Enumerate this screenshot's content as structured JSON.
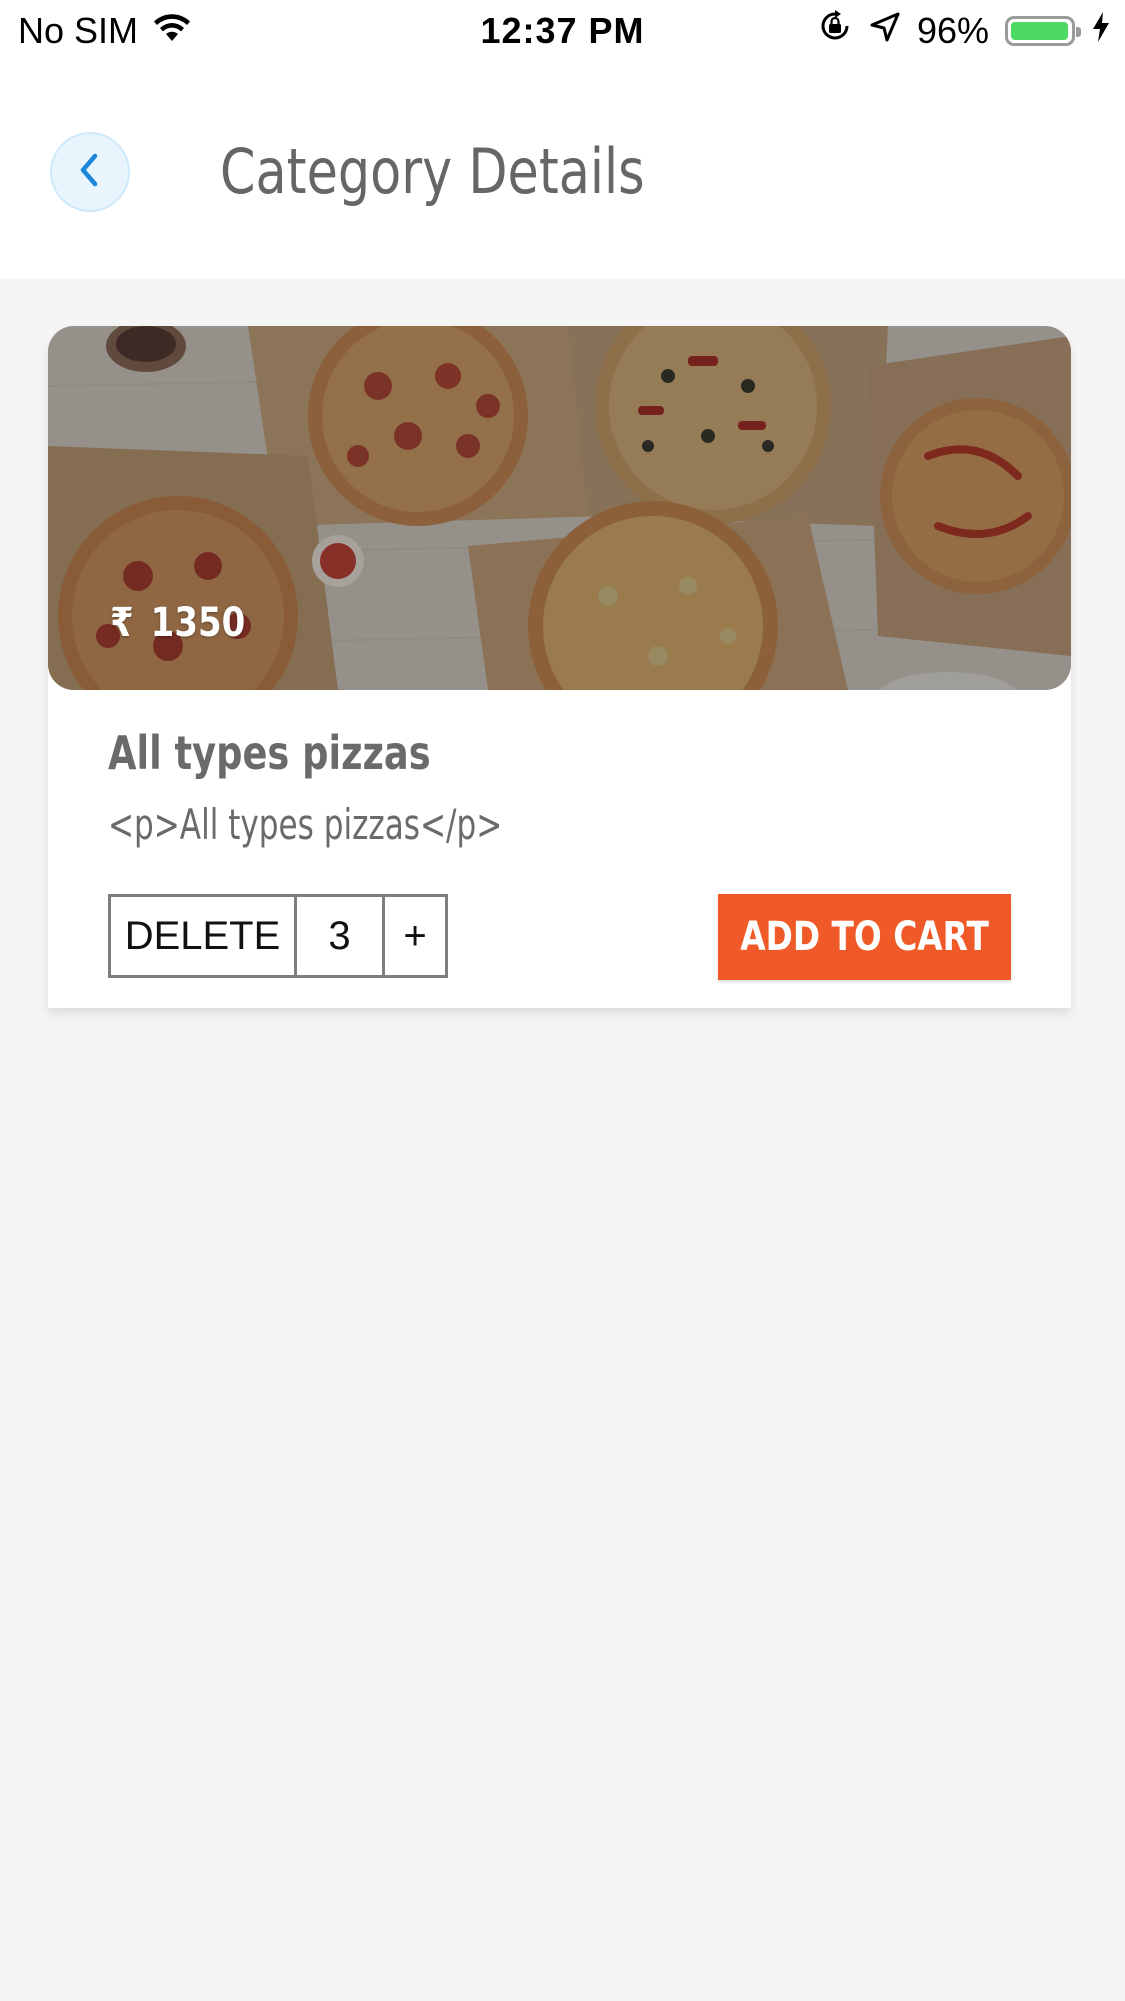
{
  "status_bar": {
    "carrier": "No SIM",
    "time": "12:37 PM",
    "battery_percent": "96%",
    "battery_level": 0.96,
    "icons": [
      "wifi-icon",
      "orientation-lock-icon",
      "location-arrow-icon",
      "battery-icon",
      "charging-bolt-icon"
    ]
  },
  "header": {
    "title": "Category Details",
    "back_icon": "chevron-left-icon",
    "accent_color": "#1e88d8"
  },
  "product": {
    "currency_symbol": "₹",
    "price": "1350",
    "title": "All types pizzas",
    "description": "<p>All types pizzas</p>",
    "image": "pizza-boxes-photo"
  },
  "cart_controls": {
    "delete_label": "DELETE",
    "quantity": "3",
    "increment_label": "+",
    "add_to_cart_label": "ADD TO CART",
    "button_color": "#f05a28"
  }
}
